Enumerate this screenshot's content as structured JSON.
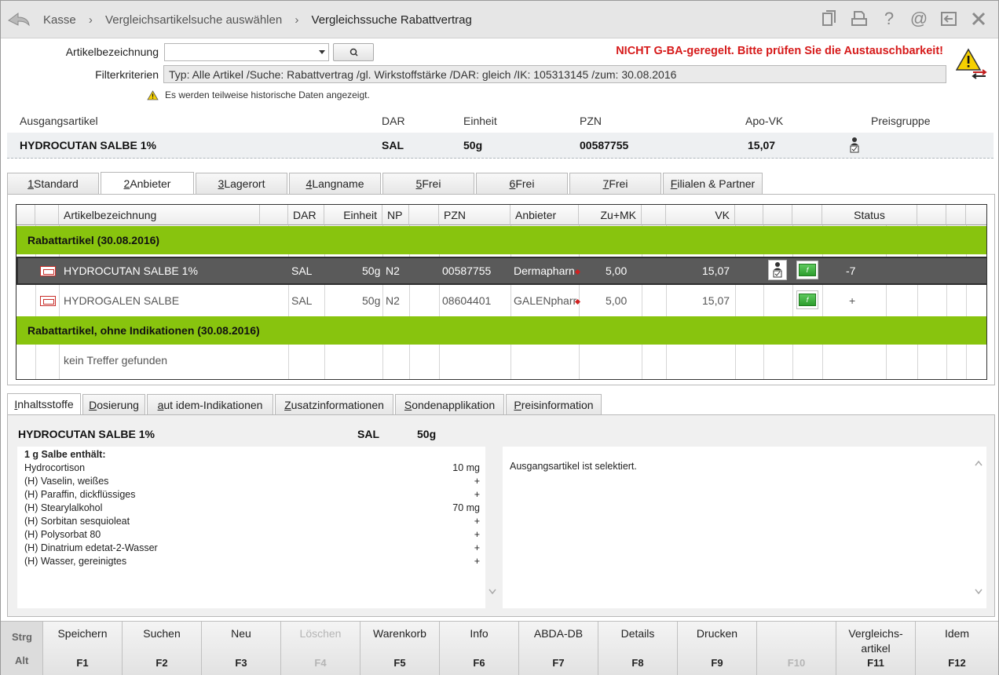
{
  "breadcrumb": {
    "items": [
      "Kasse",
      "Vergleichsartikelsuche auswählen",
      "Vergleichssuche Rabattvertrag"
    ],
    "separator": "›"
  },
  "toolbar_icons": [
    "document-icon",
    "print-icon",
    "help-icon",
    "at-icon",
    "export-icon",
    "close-icon"
  ],
  "search": {
    "artikel_label": "Artikelbezeichnung",
    "artikel_value": "",
    "filter_label": "Filterkriterien",
    "filter_value": "Typ: Alle Artikel /Suche: Rabattvertrag /gl. Wirkstoffstärke /DAR: gleich /IK: 105313145 /zum: 30.08.2016",
    "warning": "NICHT G-BA-geregelt. Bitte prüfen Sie die Austauschbarkeit!",
    "hist_note": "Es werden teilweise historische Daten angezeigt."
  },
  "ausgang": {
    "headers": {
      "artikel": "Ausgangsartikel",
      "dar": "DAR",
      "einheit": "Einheit",
      "pzn": "PZN",
      "apo_vk": "Apo-VK",
      "preisgruppe": "Preisgruppe"
    },
    "name": "HYDROCUTAN SALBE 1%",
    "dar": "SAL",
    "einheit": "50g",
    "pzn": "00587755",
    "apo_vk": "15,07"
  },
  "tabs": [
    {
      "key": "1",
      "label": " Standard"
    },
    {
      "key": "2",
      "label": " Anbieter"
    },
    {
      "key": "3",
      "label": " Lagerort"
    },
    {
      "key": "4",
      "label": " Langname"
    },
    {
      "key": "5",
      "label": " Frei"
    },
    {
      "key": "6",
      "label": " Frei"
    },
    {
      "key": "7",
      "label": " Frei"
    },
    {
      "key": "F",
      "label": "ilialen & Partner"
    }
  ],
  "grid": {
    "columns": {
      "artikel": "Artikelbezeichnung",
      "dar": "DAR",
      "einheit": "Einheit",
      "np": "NP",
      "pzn": "PZN",
      "anbieter": "Anbieter",
      "zumk": "Zu+MK",
      "vk": "VK",
      "status": "Status"
    },
    "group1": "Rabattartikel (30.08.2016)",
    "rows": [
      {
        "name": "HYDROCUTAN SALBE 1%",
        "dar": "SAL",
        "einheit": "50g",
        "np": "N2",
        "pzn": "00587755",
        "anbieter": "Dermapharn",
        "zumk": "5,00",
        "vk": "15,07",
        "status": "-7"
      },
      {
        "name": "HYDROGALEN SALBE",
        "dar": "SAL",
        "einheit": "50g",
        "np": "N2",
        "pzn": "08604401",
        "anbieter": "GALENpharr",
        "zumk": "5,00",
        "vk": "15,07",
        "status": "+"
      }
    ],
    "group2": "Rabattartikel, ohne Indikationen (30.08.2016)",
    "empty": "kein Treffer gefunden"
  },
  "lower_tabs": [
    {
      "key": "I",
      "label": "nhaltsstoffe"
    },
    {
      "key": "D",
      "label": "osierung"
    },
    {
      "key": "a",
      "label": "ut idem-Indikationen"
    },
    {
      "key": "Z",
      "label": "usatzinformationen"
    },
    {
      "key": "S",
      "label": "ondenapplikation"
    },
    {
      "key": "P",
      "label": "reisinformation"
    }
  ],
  "inhalt": {
    "name": "HYDROCUTAN SALBE 1%",
    "dar": "SAL",
    "einheit": "50g",
    "heading": "1 g Salbe enthält:",
    "items": [
      {
        "name": "Hydrocortison",
        "amount": "10 mg"
      },
      {
        "name": "(H) Vaselin, weißes",
        "amount": "+"
      },
      {
        "name": "(H) Paraffin, dickflüssiges",
        "amount": "+"
      },
      {
        "name": "(H) Stearylalkohol",
        "amount": "70 mg"
      },
      {
        "name": "(H) Sorbitan sesquioleat",
        "amount": "+"
      },
      {
        "name": "(H) Polysorbat 80",
        "amount": "+"
      },
      {
        "name": "(H) Dinatrium edetat-2-Wasser",
        "amount": "+"
      },
      {
        "name": "(H) Wasser, gereinigtes",
        "amount": "+"
      }
    ],
    "info": "Ausgangsartikel ist selektiert."
  },
  "fkeys": {
    "strg": "Strg",
    "alt": "Alt",
    "keys": [
      {
        "label": "Speichern",
        "key": "F1"
      },
      {
        "label": "Suchen",
        "key": "F2"
      },
      {
        "label": "Neu",
        "key": "F3"
      },
      {
        "label": "Löschen",
        "key": "F4"
      },
      {
        "label": "Warenkorb",
        "key": "F5"
      },
      {
        "label": "Info",
        "key": "F6"
      },
      {
        "label": "ABDA-DB",
        "key": "F7"
      },
      {
        "label": "Details",
        "key": "F8"
      },
      {
        "label": "Drucken",
        "key": "F9"
      },
      {
        "label": "",
        "key": "F10"
      },
      {
        "label": "Vergleichs-\nartikel",
        "key": "F11"
      },
      {
        "label": "Idem",
        "key": "F12"
      }
    ]
  },
  "colors": {
    "group_green": "#88c40e",
    "warning_red": "#d61a1a",
    "selected_row": "#5a5a5a"
  }
}
